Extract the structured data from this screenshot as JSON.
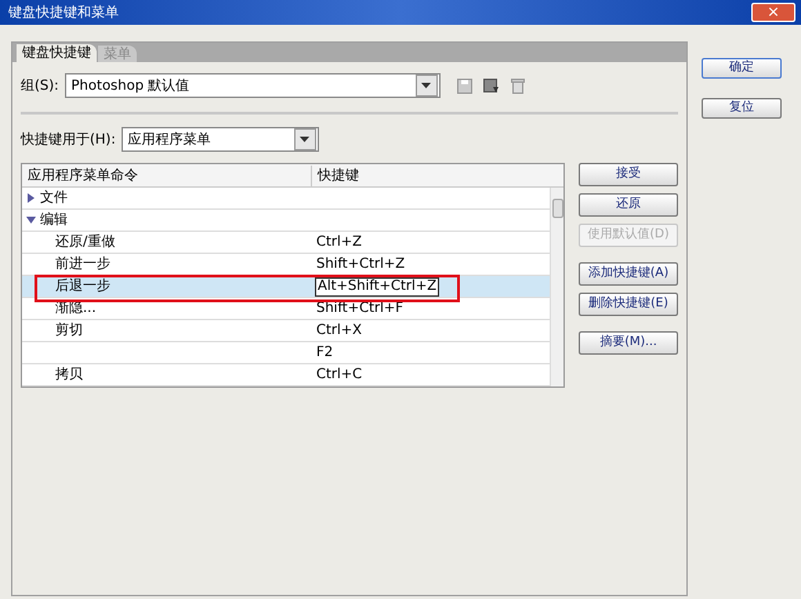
{
  "window": {
    "title": "键盘快捷键和菜单",
    "close": "×"
  },
  "tabs": [
    {
      "label": "键盘快捷键",
      "selected": true
    },
    {
      "label": "菜单",
      "selected": false
    }
  ],
  "set": {
    "label": "组(S):",
    "value": "Photoshop 默认值"
  },
  "shortcuts_for": {
    "label": "快捷键用于(H):",
    "value": "应用程序菜单"
  },
  "table": {
    "columns": [
      "应用程序菜单命令",
      "快捷键"
    ],
    "rows": [
      {
        "name": "文件",
        "expanded": false
      },
      {
        "name": "编辑",
        "expanded": true,
        "children": [
          {
            "command": "还原/重做",
            "shortcut": "Ctrl+Z",
            "selected": false
          },
          {
            "command": "前进一步",
            "shortcut": "Shift+Ctrl+Z",
            "selected": false
          },
          {
            "command": "后退一步",
            "shortcut": "Alt+Shift+Ctrl+Z",
            "selected": true
          },
          {
            "command": "渐隐...",
            "shortcut": "Shift+Ctrl+F",
            "selected": false
          },
          {
            "command": "剪切",
            "shortcut": "Ctrl+X",
            "selected": false
          },
          {
            "shortcut": "F2",
            "selected": false
          },
          {
            "command": "拷贝",
            "shortcut": "Ctrl+C",
            "selected": false
          }
        ]
      }
    ]
  },
  "side_buttons": [
    {
      "label": "接受",
      "disabled": false
    },
    {
      "label": "还原",
      "disabled": false
    },
    {
      "label": "使用默认值(D)",
      "disabled": true
    },
    {
      "label": "添加快捷键(A)",
      "disabled": false
    },
    {
      "label": "删除快捷键(E)",
      "disabled": false
    },
    {
      "label": "摘要(M)...",
      "disabled": false
    }
  ],
  "dialog_buttons": [
    "确定",
    "复位"
  ]
}
